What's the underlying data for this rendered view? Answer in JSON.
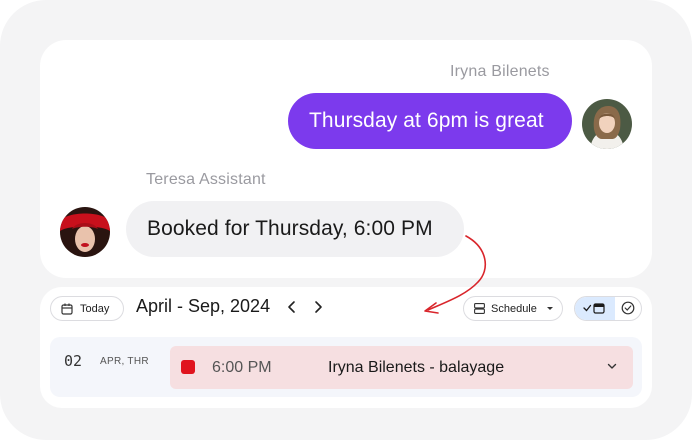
{
  "chat": {
    "user_name": "Iryna Bilenets",
    "user_message": "Thursday at 6pm is great",
    "assistant_name": "Teresa Assistant",
    "assistant_message": "Booked for Thursday, 6:00 PM"
  },
  "calendar": {
    "today_label": "Today",
    "range_title": "April - Sep, 2024",
    "view_label": "Schedule",
    "day_number": "02",
    "day_label": "APR, THR",
    "event": {
      "time": "6:00 PM",
      "title": "Iryna Bilenets - balayage",
      "color": "#e0141e"
    }
  },
  "colors": {
    "accent": "#7c3aed",
    "event_bg": "#f6dfe1",
    "arrow": "#d9252b"
  },
  "icons": [
    "calendar-icon",
    "chevron-left-icon",
    "chevron-right-icon",
    "schedule-icon",
    "caret-down-icon",
    "check-calendar-icon",
    "check-circle-icon",
    "chevron-down-icon"
  ]
}
